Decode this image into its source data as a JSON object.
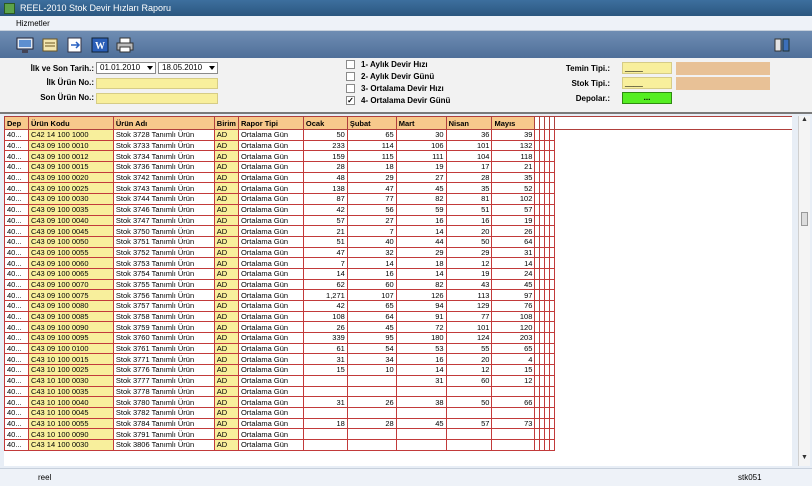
{
  "window": {
    "title": "REEL-2010 Stok Devir Hızları Raporu"
  },
  "menu": {
    "items": [
      "Hizmetler"
    ]
  },
  "filters": {
    "date_label": "İlk ve Son Tarih.:",
    "start_date": "01.01.2010",
    "end_date": "18.05.2010",
    "first_product_label": "İlk Ürün No.:",
    "last_product_label": "Son Ürün No.:",
    "options": [
      {
        "label": "1- Aylık Devir Hızı",
        "checked": false
      },
      {
        "label": "2- Aylık Devir Günü",
        "checked": false
      },
      {
        "label": "3- Ortalama Devir Hızı",
        "checked": false
      },
      {
        "label": "4- Ortalama Devir Günü",
        "checked": true
      }
    ],
    "supply_type_label": "Temin Tipi.:",
    "supply_type_value": "____",
    "stock_type_label": "Stok Tipi.:",
    "stock_type_value": "____",
    "warehouses_label": "Depolar.:",
    "warehouses_value": "..."
  },
  "grid": {
    "headers": [
      "Dep",
      "Ürün Kodu",
      "Ürün Adı",
      "Birim",
      "Rapor Tipi",
      "Ocak",
      "Şubat",
      "Mart",
      "Nisan",
      "Mayıs"
    ],
    "rows": [
      [
        "40...",
        "C42 14 100 1000",
        "Stok 3728 Tanımlı Ürün",
        "AD",
        "Ortalama Gün",
        "50",
        "65",
        "30",
        "36",
        "39"
      ],
      [
        "40...",
        "C43 09 100 0010",
        "Stok 3733 Tanımlı Ürün",
        "AD",
        "Ortalama Gün",
        "233",
        "114",
        "106",
        "101",
        "132"
      ],
      [
        "40...",
        "C43 09 100 0012",
        "Stok 3734 Tanımlı Ürün",
        "AD",
        "Ortalama Gün",
        "159",
        "115",
        "111",
        "104",
        "118"
      ],
      [
        "40...",
        "C43 09 100 0015",
        "Stok 3736 Tanımlı Ürün",
        "AD",
        "Ortalama Gün",
        "28",
        "18",
        "19",
        "17",
        "21"
      ],
      [
        "40...",
        "C43 09 100 0020",
        "Stok 3742 Tanımlı Ürün",
        "AD",
        "Ortalama Gün",
        "48",
        "29",
        "27",
        "28",
        "35"
      ],
      [
        "40...",
        "C43 09 100 0025",
        "Stok 3743 Tanımlı Ürün",
        "AD",
        "Ortalama Gün",
        "138",
        "47",
        "45",
        "35",
        "52"
      ],
      [
        "40...",
        "C43 09 100 0030",
        "Stok 3744 Tanımlı Ürün",
        "AD",
        "Ortalama Gün",
        "87",
        "77",
        "82",
        "81",
        "102"
      ],
      [
        "40...",
        "C43 09 100 0035",
        "Stok 3746 Tanımlı Ürün",
        "AD",
        "Ortalama Gün",
        "42",
        "56",
        "59",
        "51",
        "57"
      ],
      [
        "40...",
        "C43 09 100 0040",
        "Stok 3747 Tanımlı Ürün",
        "AD",
        "Ortalama Gün",
        "57",
        "27",
        "16",
        "16",
        "19"
      ],
      [
        "40...",
        "C43 09 100 0045",
        "Stok 3750 Tanımlı Ürün",
        "AD",
        "Ortalama Gün",
        "21",
        "7",
        "14",
        "20",
        "26"
      ],
      [
        "40...",
        "C43 09 100 0050",
        "Stok 3751 Tanımlı Ürün",
        "AD",
        "Ortalama Gün",
        "51",
        "40",
        "44",
        "50",
        "64"
      ],
      [
        "40...",
        "C43 09 100 0055",
        "Stok 3752 Tanımlı Ürün",
        "AD",
        "Ortalama Gün",
        "47",
        "32",
        "29",
        "29",
        "31"
      ],
      [
        "40...",
        "C43 09 100 0060",
        "Stok 3753 Tanımlı Ürün",
        "AD",
        "Ortalama Gün",
        "7",
        "14",
        "18",
        "12",
        "14"
      ],
      [
        "40...",
        "C43 09 100 0065",
        "Stok 3754 Tanımlı Ürün",
        "AD",
        "Ortalama Gün",
        "14",
        "16",
        "14",
        "19",
        "24"
      ],
      [
        "40...",
        "C43 09 100 0070",
        "Stok 3755 Tanımlı Ürün",
        "AD",
        "Ortalama Gün",
        "62",
        "60",
        "82",
        "43",
        "45"
      ],
      [
        "40...",
        "C43 09 100 0075",
        "Stok 3756 Tanımlı Ürün",
        "AD",
        "Ortalama Gün",
        "1,271",
        "107",
        "126",
        "113",
        "97"
      ],
      [
        "40...",
        "C43 09 100 0080",
        "Stok 3757 Tanımlı Ürün",
        "AD",
        "Ortalama Gün",
        "42",
        "65",
        "94",
        "129",
        "76"
      ],
      [
        "40...",
        "C43 09 100 0085",
        "Stok 3758 Tanımlı Ürün",
        "AD",
        "Ortalama Gün",
        "108",
        "64",
        "91",
        "77",
        "108"
      ],
      [
        "40...",
        "C43 09 100 0090",
        "Stok 3759 Tanımlı Ürün",
        "AD",
        "Ortalama Gün",
        "26",
        "45",
        "72",
        "101",
        "120"
      ],
      [
        "40...",
        "C43 09 100 0095",
        "Stok 3760 Tanımlı Ürün",
        "AD",
        "Ortalama Gün",
        "339",
        "95",
        "180",
        "124",
        "203"
      ],
      [
        "40...",
        "C43 09 100 0100",
        "Stok 3761 Tanımlı Ürün",
        "AD",
        "Ortalama Gün",
        "61",
        "54",
        "53",
        "55",
        "65"
      ],
      [
        "40...",
        "C43 10 100 0015",
        "Stok 3771 Tanımlı Ürün",
        "AD",
        "Ortalama Gün",
        "31",
        "34",
        "16",
        "20",
        "4"
      ],
      [
        "40...",
        "C43 10 100 0025",
        "Stok 3776 Tanımlı Ürün",
        "AD",
        "Ortalama Gün",
        "15",
        "10",
        "14",
        "12",
        "15"
      ],
      [
        "40...",
        "C43 10 100 0030",
        "Stok 3777 Tanımlı Ürün",
        "AD",
        "Ortalama Gün",
        "",
        "",
        "31",
        "60",
        "12"
      ],
      [
        "40...",
        "C43 10 100 0035",
        "Stok 3778 Tanımlı Ürün",
        "AD",
        "Ortalama Gün",
        "",
        "",
        "",
        "",
        ""
      ],
      [
        "40...",
        "C43 10 100 0040",
        "Stok 3780 Tanımlı Ürün",
        "AD",
        "Ortalama Gün",
        "31",
        "26",
        "38",
        "50",
        "66"
      ],
      [
        "40...",
        "C43 10 100 0045",
        "Stok 3782 Tanımlı Ürün",
        "AD",
        "Ortalama Gün",
        "",
        "",
        "",
        "",
        ""
      ],
      [
        "40...",
        "C43 10 100 0055",
        "Stok 3784 Tanımlı Ürün",
        "AD",
        "Ortalama Gün",
        "18",
        "28",
        "45",
        "57",
        "73"
      ],
      [
        "40...",
        "C43 10 100 0090",
        "Stok 3791 Tanımlı Ürün",
        "AD",
        "Ortalama Gün",
        "",
        "",
        "",
        "",
        ""
      ],
      [
        "40...",
        "C43 14 100 0030",
        "Stok 3806 Tanımlı Ürün",
        "AD",
        "Ortalama Gün",
        "",
        "",
        "",
        "",
        ""
      ]
    ]
  },
  "status": {
    "left": "reel",
    "right": "stk051"
  },
  "colors": {
    "yellow_field": "#f8ef9c",
    "tan_field": "#e8c196",
    "green_button": "#55ee22",
    "grid_line": "#c23a3a",
    "header_bg": "#f7c98c"
  },
  "icons": [
    "computer-icon",
    "report-icon",
    "export-icon",
    "word-icon",
    "printer-icon",
    "settings-icon"
  ]
}
